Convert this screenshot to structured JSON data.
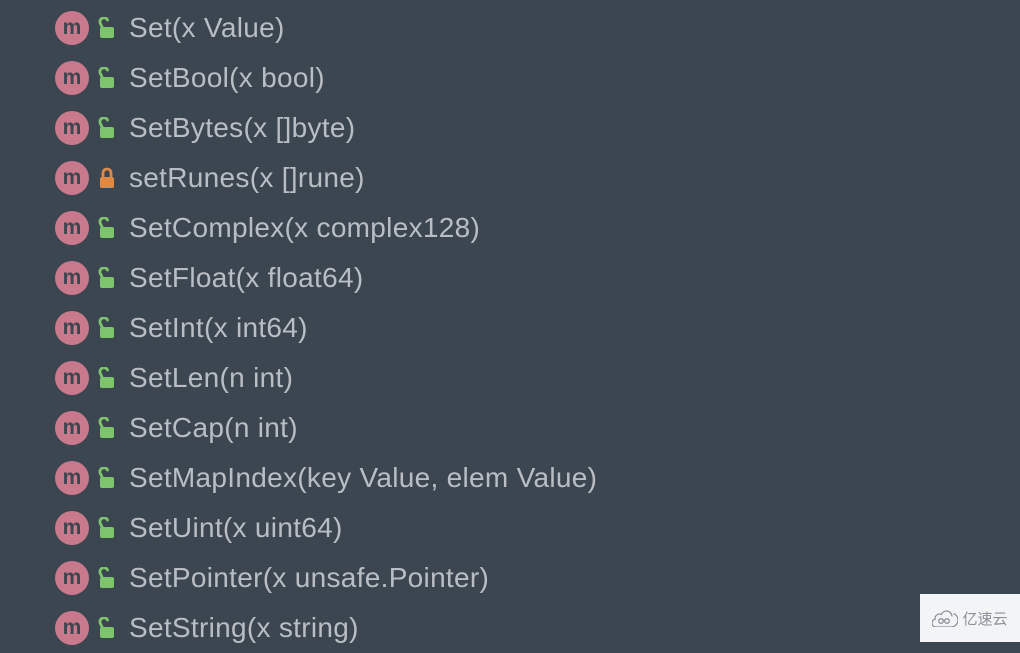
{
  "methods": [
    {
      "icon": "m",
      "visibility": "public",
      "label": "Set(x Value)"
    },
    {
      "icon": "m",
      "visibility": "public",
      "label": "SetBool(x bool)"
    },
    {
      "icon": "m",
      "visibility": "public",
      "label": "SetBytes(x []byte)"
    },
    {
      "icon": "m",
      "visibility": "private",
      "label": "setRunes(x []rune)"
    },
    {
      "icon": "m",
      "visibility": "public",
      "label": "SetComplex(x complex128)"
    },
    {
      "icon": "m",
      "visibility": "public",
      "label": "SetFloat(x float64)"
    },
    {
      "icon": "m",
      "visibility": "public",
      "label": "SetInt(x int64)"
    },
    {
      "icon": "m",
      "visibility": "public",
      "label": "SetLen(n int)"
    },
    {
      "icon": "m",
      "visibility": "public",
      "label": "SetCap(n int)"
    },
    {
      "icon": "m",
      "visibility": "public",
      "label": "SetMapIndex(key Value, elem Value)"
    },
    {
      "icon": "m",
      "visibility": "public",
      "label": "SetUint(x uint64)"
    },
    {
      "icon": "m",
      "visibility": "public",
      "label": "SetPointer(x unsafe.Pointer)"
    },
    {
      "icon": "m",
      "visibility": "public",
      "label": "SetString(x string)"
    }
  ],
  "watermark": {
    "text": "亿速云"
  }
}
